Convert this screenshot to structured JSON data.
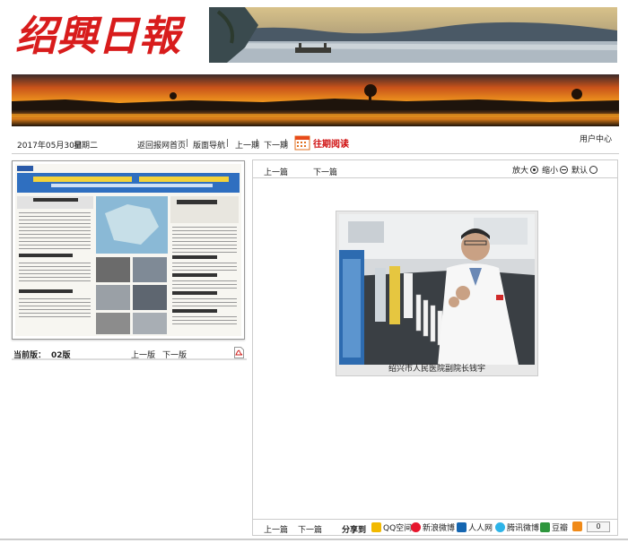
{
  "header": {
    "logo_text": "绍興日報"
  },
  "nav": {
    "date": "2017年05月30日",
    "weekday": "星期二",
    "home_link": "返回报网首页",
    "layout_nav": "版面导航",
    "prev_issue": "上一期",
    "next_issue": "下一期",
    "archive": "往期阅读",
    "user_center": "用户中心",
    "sep": "|"
  },
  "left": {
    "current_label": "当前版：",
    "current_value": "02版",
    "prev_page": "上一版",
    "next_page": "下一版"
  },
  "right": {
    "prev_article": "上一篇",
    "next_article": "下一篇",
    "zoom_in": "放大",
    "zoom_out": "缩小",
    "default": "默认",
    "caption": "绍兴市人民医院副院长钱宇",
    "share_label": "分享到",
    "share": [
      "QQ空间",
      "新浪微博",
      "人人网",
      "腾讯微博",
      "豆瓣"
    ],
    "count": "0"
  },
  "colors": {
    "brand_red": "#d01010",
    "share_qzone": "#f2b900",
    "share_sina": "#e6162d",
    "share_renren": "#1566b1",
    "share_tencent": "#2eb4e8",
    "share_douban": "#2e963d",
    "share_more": "#f08a18"
  }
}
